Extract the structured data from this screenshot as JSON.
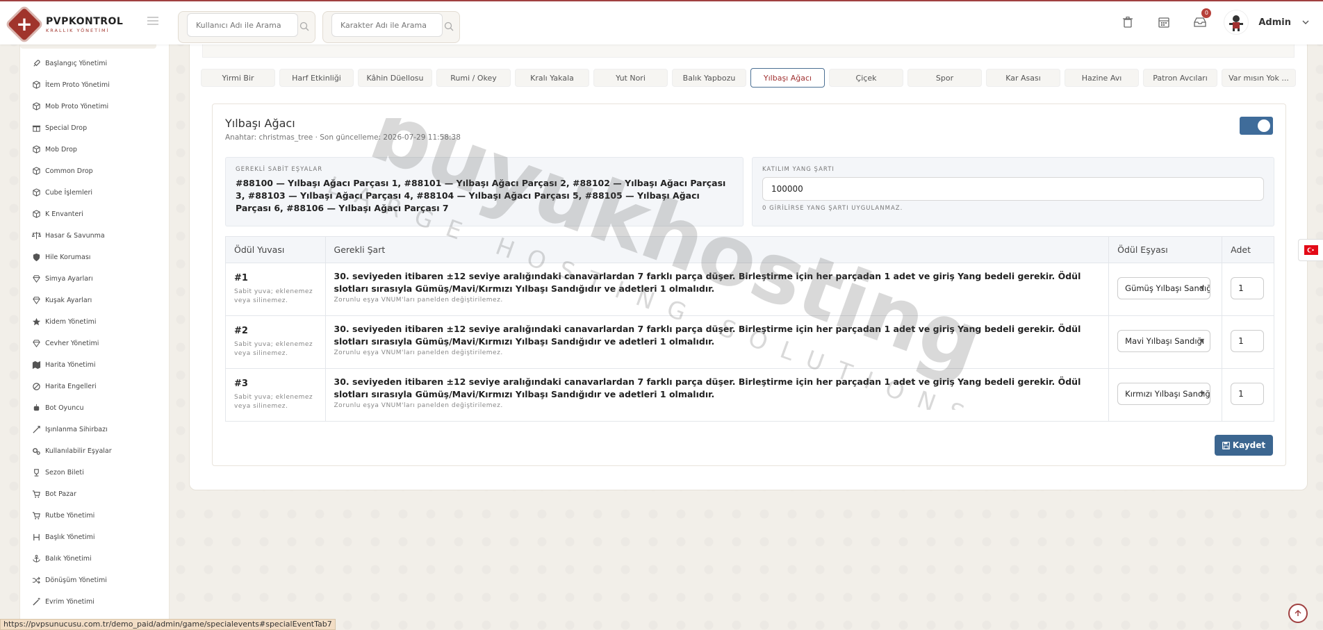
{
  "brand": {
    "title": "PVPKONTROL",
    "subtitle": "KRALLIK YÖNETİMİ"
  },
  "search": {
    "user_placeholder": "Kullanıcı Adı ile Arama",
    "character_placeholder": "Karakter Adı ile Arama"
  },
  "header": {
    "notification_count": "0",
    "admin_name": "Admin"
  },
  "sidebar": {
    "items": [
      {
        "label": "Başlangıç Yönetimi",
        "icon": "rocket-icon"
      },
      {
        "label": "İtem Proto Yönetimi",
        "icon": "cube-icon"
      },
      {
        "label": "Mob Proto Yönetimi",
        "icon": "cube-icon"
      },
      {
        "label": "Special Drop",
        "icon": "gift-icon"
      },
      {
        "label": "Mob Drop",
        "icon": "cube-icon"
      },
      {
        "label": "Common Drop",
        "icon": "cube-icon"
      },
      {
        "label": "Cube İşlemleri",
        "icon": "cube-icon"
      },
      {
        "label": "K Envanteri",
        "icon": "cube-icon"
      },
      {
        "label": "Hasar & Savunma",
        "icon": "scale-icon"
      },
      {
        "label": "Hile Koruması",
        "icon": "shield-icon"
      },
      {
        "label": "Simya Ayarları",
        "icon": "gem-icon"
      },
      {
        "label": "Kuşak Ayarları",
        "icon": "gem-icon"
      },
      {
        "label": "Kidem Yönetimi",
        "icon": "star-icon"
      },
      {
        "label": "Cevher Yönetimi",
        "icon": "gem-icon"
      },
      {
        "label": "Harita Yönetimi",
        "icon": "map-icon"
      },
      {
        "label": "Harita Engelleri",
        "icon": "ban-icon"
      },
      {
        "label": "Bot Oyuncu",
        "icon": "bot-icon"
      },
      {
        "label": "Işınlanma Sihirbazı",
        "icon": "teleport-icon"
      },
      {
        "label": "Kullanılabilir Eşyalar",
        "icon": "gears-icon"
      },
      {
        "label": "Sezon Bileti",
        "icon": "trophy-icon"
      },
      {
        "label": "Bot Pazar",
        "icon": "cart-icon"
      },
      {
        "label": "Rutbe Yönetimi",
        "icon": "cart-icon"
      },
      {
        "label": "Başlık Yönetimi",
        "icon": "heading-icon"
      },
      {
        "label": "Balık Yönetimi",
        "icon": "anchor-icon"
      },
      {
        "label": "Dönüşüm Yönetimi",
        "icon": "shuffle-icon"
      },
      {
        "label": "Evrim Yönetimi",
        "icon": "wand-icon"
      }
    ]
  },
  "tabs": [
    {
      "label": "Yirmi Bir"
    },
    {
      "label": "Harf Etkinliği"
    },
    {
      "label": "Kâhin Düellosu"
    },
    {
      "label": "Rumi / Okey"
    },
    {
      "label": "Kralı Yakala"
    },
    {
      "label": "Yut Nori"
    },
    {
      "label": "Balık Yapbozu"
    },
    {
      "label": "Yılbaşı Ağacı",
      "active": true
    },
    {
      "label": "Çiçek"
    },
    {
      "label": "Spor"
    },
    {
      "label": "Kar Asası"
    },
    {
      "label": "Hazine Avı"
    },
    {
      "label": "Patron Avcıları"
    },
    {
      "label": "Var mısın Yok ..."
    }
  ],
  "event": {
    "title": "Yılbaşı Ağacı",
    "meta": "Anahtar: christmas_tree · Son güncelleme: 2026-07-29 11:58:38",
    "enabled": true,
    "required_items_label": "GEREKLİ SABİT EŞYALAR",
    "required_items": "#88100 — Yılbaşı Ağacı Parçası 1, #88101 — Yılbaşı Ağacı Parçası 2, #88102 — Yılbaşı Ağacı Parçası 3, #88103 — Yılbaşı Ağacı Parçası 4, #88104 — Yılbaşı Ağacı Parçası 5, #88105 — Yılbaşı Ağacı Parçası 6, #88106 — Yılbaşı Ağacı Parçası 7",
    "yang_label": "KATILIM YANG ŞARTI",
    "yang_value": "100000",
    "yang_help": "0 GİRİLİRSE YANG ŞARTI UYGULANMAZ."
  },
  "table": {
    "headers": [
      "Ödül Yuvası",
      "Gerekli Şart",
      "Ödül Eşyası",
      "Adet"
    ],
    "rows": [
      {
        "slot": "#1",
        "slot_note": "Sabit yuva; eklenemez veya silinemez.",
        "condition": "30. seviyeden itibaren ±12 seviye aralığındaki canavarlardan 7 farklı parça düşer. Birleştirme için her parçadan 1 adet ve giriş Yang bedeli gerekir. Ödül slotları sırasıyla Gümüş/Mavi/Kırmızı Yılbaşı Sandığıdır ve adetleri 1 olmalıdır.",
        "condition_note": "Zorunlu eşya VNUM'ları panelden değiştirilemez.",
        "reward": "Gümüş Yılbaşı Sandığı",
        "qty": "1"
      },
      {
        "slot": "#2",
        "slot_note": "Sabit yuva; eklenemez veya silinemez.",
        "condition": "30. seviyeden itibaren ±12 seviye aralığındaki canavarlardan 7 farklı parça düşer. Birleştirme için her parçadan 1 adet ve giriş Yang bedeli gerekir. Ödül slotları sırasıyla Gümüş/Mavi/Kırmızı Yılbaşı Sandığıdır ve adetleri 1 olmalıdır.",
        "condition_note": "Zorunlu eşya VNUM'ları panelden değiştirilemez.",
        "reward": "Mavi Yılbaşı Sandığı",
        "qty": "1"
      },
      {
        "slot": "#3",
        "slot_note": "Sabit yuva; eklenemez veya silinemez.",
        "condition": "30. seviyeden itibaren ±12 seviye aralığındaki canavarlardan 7 farklı parça düşer. Birleştirme için her parçadan 1 adet ve giriş Yang bedeli gerekir. Ödül slotları sırasıyla Gümüş/Mavi/Kırmızı Yılbaşı Sandığıdır ve adetleri 1 olmalıdır.",
        "condition_note": "Zorunlu eşya VNUM'ları panelden değiştirilemez.",
        "reward": "Kırmızı Yılbaşı Sandığı",
        "qty": "1"
      }
    ]
  },
  "save_label": "Kaydet",
  "status_url": "https://pvpsunucusu.com.tr/demo_paid/admin/game/specialevents#specialEventTab7",
  "watermark": {
    "main": "buyukhosting",
    "sub": "LARGE HOSTING SOLUTIONS"
  },
  "colors": {
    "accent": "#3c6690",
    "brand": "#a0342c",
    "active_tab_text": "#a03030"
  }
}
